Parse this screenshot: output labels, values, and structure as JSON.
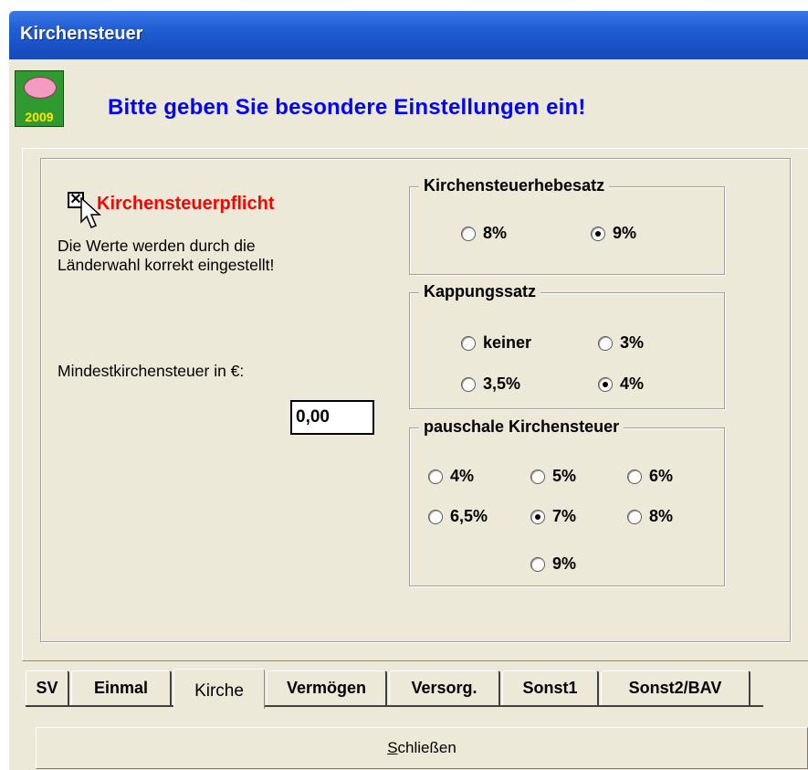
{
  "window": {
    "title": "Kirchensteuer"
  },
  "logo": {
    "year": "2009"
  },
  "header": {
    "message": "Bitte geben Sie besondere Einstellungen ein!"
  },
  "left": {
    "checkbox": {
      "label": "Kirchensteuerpflicht",
      "checked": true
    },
    "hint_line1": "Die Werte werden durch die",
    "hint_line2": "Länderwahl korrekt eingestellt!",
    "mindest_label": "Mindestkirchensteuer in €:",
    "mindest_value": "0,00"
  },
  "groups": {
    "hebesatz": {
      "title": "Kirchensteuerhebesatz",
      "options": [
        {
          "label": "8%",
          "selected": false
        },
        {
          "label": "9%",
          "selected": true
        }
      ]
    },
    "kappung": {
      "title": "Kappungssatz",
      "options": [
        {
          "label": "keiner",
          "selected": false
        },
        {
          "label": "3%",
          "selected": false
        },
        {
          "label": "3,5%",
          "selected": false
        },
        {
          "label": "4%",
          "selected": true
        }
      ]
    },
    "pauschale": {
      "title": "pauschale Kirchensteuer",
      "options": [
        {
          "label": "4%",
          "selected": false
        },
        {
          "label": "5%",
          "selected": false
        },
        {
          "label": "6%",
          "selected": false
        },
        {
          "label": "6,5%",
          "selected": false
        },
        {
          "label": "7%",
          "selected": true
        },
        {
          "label": "8%",
          "selected": false
        },
        {
          "label": "9%",
          "selected": false
        }
      ]
    }
  },
  "tabs": [
    {
      "label": "SV",
      "active": false
    },
    {
      "label": "Einmal",
      "active": false
    },
    {
      "label": "Kirche",
      "active": true
    },
    {
      "label": "Vermögen",
      "active": false
    },
    {
      "label": "Versorg.",
      "active": false
    },
    {
      "label": "Sonst1",
      "active": false
    },
    {
      "label": "Sonst2/BAV",
      "active": false
    }
  ],
  "footer": {
    "close_label_prefix": "S",
    "close_label_rest": "chließen"
  },
  "colors": {
    "title_bar": "#2260d6",
    "header_text": "#0000ff",
    "checkbox_label": "#ff0000",
    "dialog_bg": "#ece9d8"
  }
}
